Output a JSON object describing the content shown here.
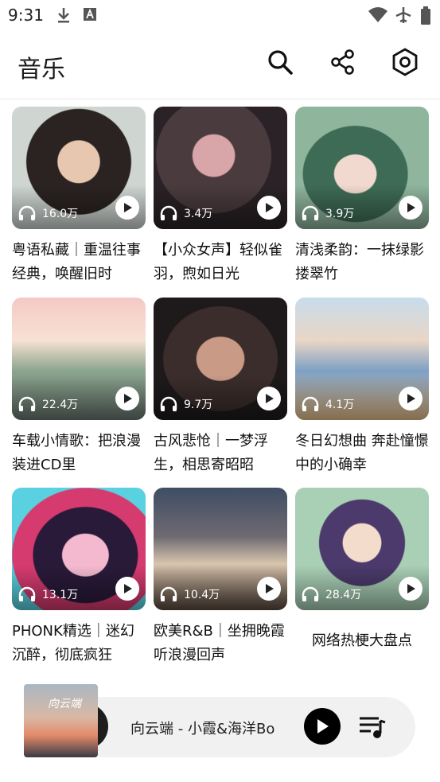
{
  "status_bar": {
    "time": "9:31"
  },
  "app_bar": {
    "title": "音乐"
  },
  "playlists": [
    {
      "title": "粤语私藏｜重温往事经典，唤醒旧时",
      "plays": "16.0万"
    },
    {
      "title": "【小众女声】轻似雀羽，煦如日光",
      "plays": "3.4万"
    },
    {
      "title": "清浅柔韵：一抹绿影搂翠竹",
      "plays": "3.9万"
    },
    {
      "title": "车载小情歌：把浪漫装进CD里",
      "plays": "22.4万"
    },
    {
      "title": "古风悲怆｜一梦浮生，相思寄昭昭",
      "plays": "9.7万"
    },
    {
      "title": "冬日幻想曲 奔赴憧憬中的小确幸",
      "plays": "4.1万"
    },
    {
      "title": "PHONK精选｜迷幻沉醉，彻底疯狂",
      "plays": "13.1万"
    },
    {
      "title": "欧美R&B｜坐拥晚霞听浪漫回声",
      "plays": "10.4万"
    },
    {
      "title": "网络热梗大盘点",
      "plays": "28.4万"
    }
  ],
  "mini_player": {
    "song": "向云端 - 小霞&海洋Bo",
    "cover_text": "向云端"
  }
}
